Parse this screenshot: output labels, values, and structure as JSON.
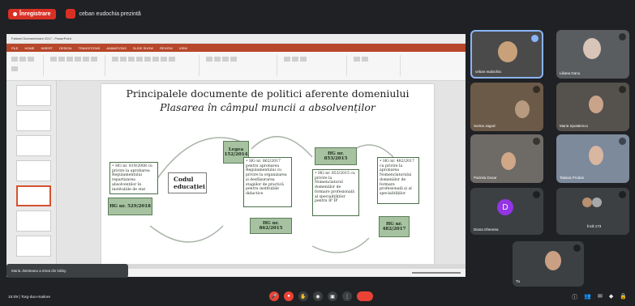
{
  "meeting": {
    "recording_label": "Înregistrare",
    "presenter_label": "ceban eudochia prezintă",
    "time_label": "15:09 | Torg-duo-mailore",
    "toast_text": "Maria Jlotsteanu a intrat din lobby."
  },
  "ppt": {
    "window_title": "Fatiorel Dezmembrare 2017 - PowerPoint",
    "ribbon_tabs": [
      "FILE",
      "HOME",
      "INSERT",
      "DESIGN",
      "TRANSITIONS",
      "ANIMATIONS",
      "SLIDE SHOW",
      "REVIEW",
      "VIEW"
    ]
  },
  "slide": {
    "title_line1": "Principalele documente de politici aferente domeniului",
    "title_line2": "Plasarea în câmpul muncii a absolvenților",
    "center_label": "Codul educației",
    "box_lege": "Legea 152/2014",
    "box_hg_529": "HG nr. 529/2018",
    "box_hg_862": "HG nr. 862/2015",
    "box_hg_853": "HG nr. 853/2015",
    "box_hg_482": "HG nr. 482/2017",
    "text_left": "• HG nr. 819/2008 cu privire la aprobarea Regulamentului repartizarea absolvenților în instituțiile de stat",
    "text_mid": "• HG nr. 862/2017 pentru aprobarea Regulamentului cu privire la organizarea și desfășurarea stagiilor de practică pentru instituțiile didactice",
    "text_right1": "• HG nr. 853/2015 cu privire la Nomenclatorul domeniilor de formare profesională al specialităților pentru IP ÎP",
    "text_right2": "• HG nr. 482/2017 cu privire la aprobarea Nomenclatorului domeniilor de formare profesională și al specialităților"
  },
  "participants": [
    {
      "name": "ceban eudochia"
    },
    {
      "name": "Liliana Ganu"
    },
    {
      "name": "Sorina Jagod"
    },
    {
      "name": "Maria Spotalenco"
    },
    {
      "name": "Parinita Dosar"
    },
    {
      "name": "Tatiana Prodan"
    },
    {
      "name": "Diana Gheorea",
      "initial": "D"
    },
    {
      "name": "Încă 173"
    },
    {
      "name": "Tu"
    }
  ],
  "colors": {
    "meet_bg": "#202124",
    "tile_bg": "#3c4043",
    "accent_red": "#ea4335",
    "ppt_orange": "#b7472a",
    "slide_green": "#a6c2a0",
    "avatar_purple": "#9334e6"
  }
}
